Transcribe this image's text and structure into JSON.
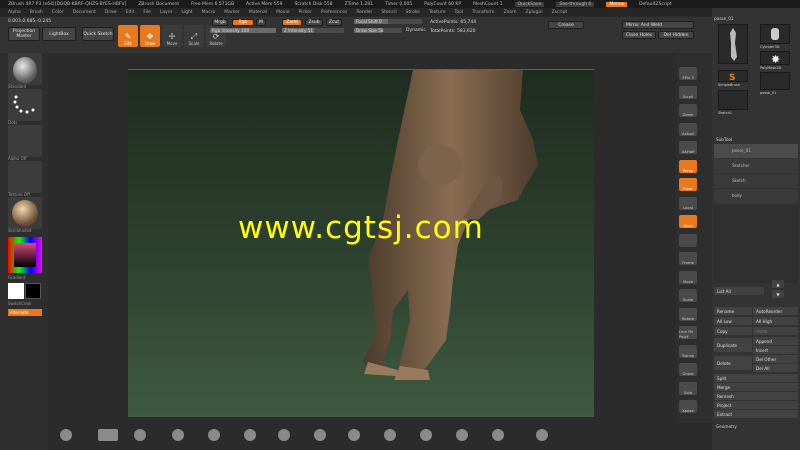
{
  "titlebar": {
    "app": "ZBrush 4R7 P3 (x64)[DGQB-KBRF-QHZS-BYES-HBFV]",
    "doc": "ZBrush Document",
    "free_mem": "Free Mem 6.571GB",
    "active_mem": "Active Mem 559",
    "scratch_disk": "Scratch Disk 558",
    "ztime": "ZTime 1.281",
    "timer": "Timer 0.005",
    "polycount": "PolyCount 60 KP",
    "meshcount": "MeshCount 1",
    "quicksave": "QuickSave",
    "seethrough": "See-through 0",
    "menus": "Menus",
    "default_zscript": "DefaultZScript"
  },
  "menubar": [
    "Alpha",
    "Brush",
    "Color",
    "Document",
    "Draw",
    "Edit",
    "File",
    "Layer",
    "Light",
    "Macro",
    "Marker",
    "Material",
    "Movie",
    "Picker",
    "Preferences",
    "Render",
    "Stencil",
    "Stroke",
    "Texture",
    "Tool",
    "Transform",
    "Zoom",
    "Zplugin",
    "Zscript"
  ],
  "toolbar": {
    "coords": "0.003,0.685,-0.245",
    "projection_master": "Projection Master",
    "lightbox": "LightBox",
    "quick_sketch": "Quick Sketch",
    "tools": [
      {
        "label": "Edit",
        "glyph": "✎",
        "active": true
      },
      {
        "label": "Draw",
        "glyph": "✥",
        "active": true
      },
      {
        "label": "Move",
        "glyph": "✢",
        "active": false
      },
      {
        "label": "Scale",
        "glyph": "⤢",
        "active": false
      },
      {
        "label": "Rotate",
        "glyph": "⟳",
        "active": false
      }
    ],
    "mrgb": "Mrgb",
    "rgb": "Rgb",
    "m": "M",
    "rgb_intensity": "Rgb Intensity 100",
    "rgb_intensity_value": 100,
    "zadd": "Zadd",
    "zsub": "Zsub",
    "zcut": "Zcut",
    "z_intensity": "Z Intensity 51",
    "z_intensity_value": 51,
    "focal_shift": "Focal Shift 0",
    "focal_shift_value": 0,
    "draw_size": "Draw Size 58",
    "draw_size_value": 58,
    "dynamic": "Dynamic",
    "active_points": "ActivePoints: 65,744",
    "total_points": "TotalPoints: 583,620",
    "crease": "Crease",
    "mirror_and_weld": "Mirror And Weld",
    "close_holes": "Close Holes",
    "del_hidden": "Del Hidden"
  },
  "leftshelf": {
    "brush_label": "Standard",
    "stroke_label": "Dots",
    "alpha_label": "Alpha Off",
    "texture_label": "Texture Off",
    "material_label": "SkinShade4",
    "gradient": "Gradient",
    "switchcolor": "SwitchColor",
    "alternate": "Alternate"
  },
  "canvas": {
    "watermark": "www.cgtsj.com",
    "bg_top": "#1e2b1f",
    "bg_bottom": "#3f5a40",
    "skin": "#7a6148"
  },
  "rightcol": [
    "SPix 3",
    "Scroll",
    "Zoom",
    "Actual",
    "AAHalf",
    "Persp",
    "Floor",
    "Local",
    "Qxyz",
    "",
    "Frame",
    "Move",
    "Scale",
    "Rotate",
    "Line Fill PolyF",
    "Transp",
    "Ghost",
    "Solo",
    "Xpose"
  ],
  "rightpanel": {
    "header": "posse_01",
    "tools": [
      "Cylinder3D",
      "PolyMesh3D",
      "SimpleBrush",
      "posse_01",
      "Sketch1"
    ],
    "subtool": "SubTool",
    "subtool_items": [
      "posse_01",
      "Sketcher",
      "Sketch",
      "body"
    ],
    "list_all": "List All",
    "rename": "Rename",
    "autoreorder": "AutoReorder",
    "all_low": "All Low",
    "all_high": "All High",
    "copy": "Copy",
    "paste": "Paste",
    "duplicate": "Duplicate",
    "append": "Append",
    "insert": "Insert",
    "delete": "Delete",
    "del_other": "Del Other",
    "del_all": "Del All",
    "split": "Split",
    "merge": "Merge",
    "remesh": "Remesh",
    "project": "Project",
    "extract": "Extract",
    "geometry": "Geometry"
  },
  "colors": {
    "accent": "#e9791e",
    "panel": "#333333",
    "watermark": "#ffff00"
  }
}
